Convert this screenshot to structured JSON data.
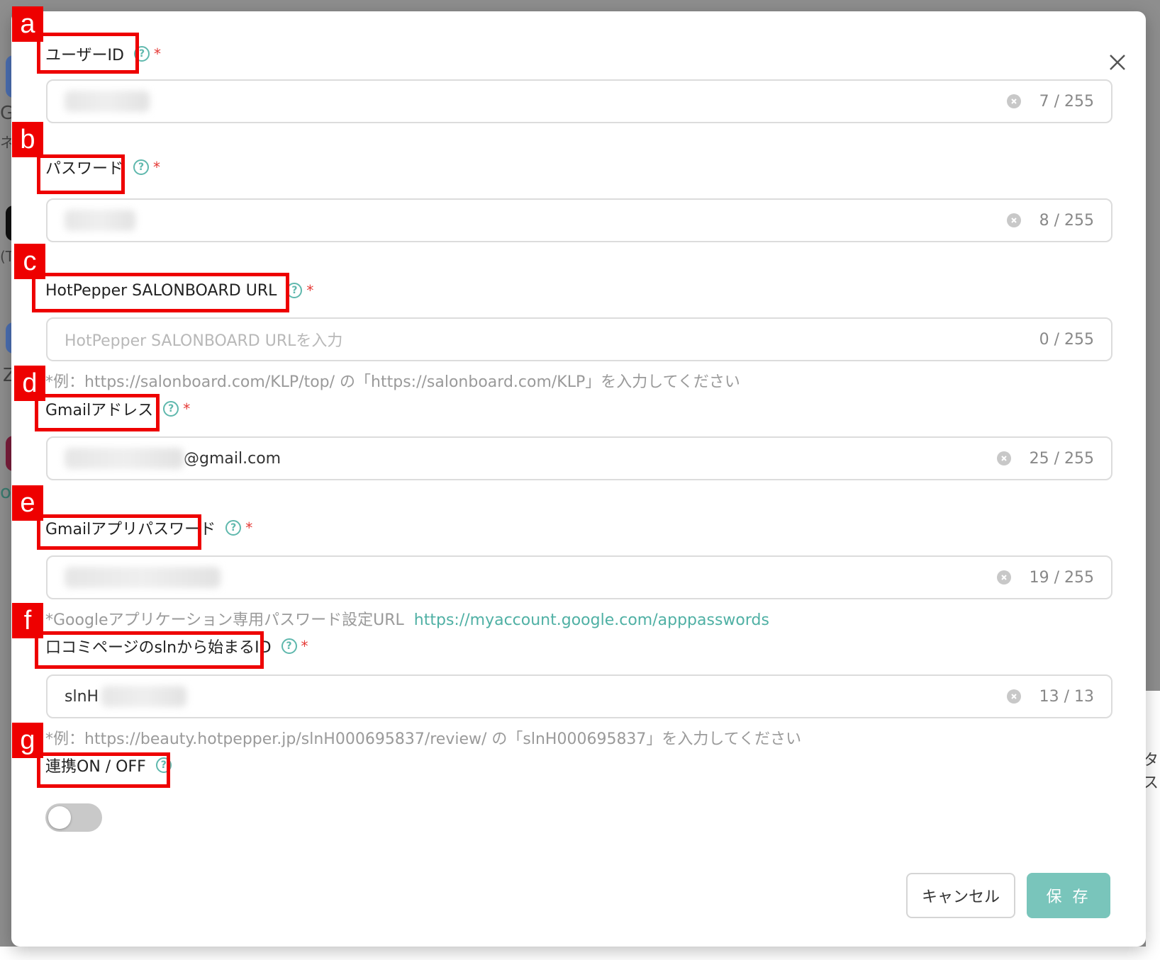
{
  "background": {
    "fragments": [
      "G",
      "ネス",
      "(T",
      "Z",
      "o",
      "タス"
    ]
  },
  "modal": {
    "fields": [
      {
        "label": "ユーザーID",
        "value_suffix": "",
        "placeholder": "",
        "counter": "7 / 255",
        "clearable": true
      },
      {
        "label": "パスワード",
        "value_suffix": "",
        "placeholder": "",
        "counter": "8 / 255",
        "clearable": true
      },
      {
        "label": "HotPepper SALONBOARD URL",
        "value_suffix": "",
        "placeholder": "HotPepper SALONBOARD URLを入力",
        "counter": "0 / 255",
        "clearable": false,
        "hint": "*例：https://salonboard.com/KLP/top/ の「https://salonboard.com/KLP」を入力してください"
      },
      {
        "label": "Gmailアドレス",
        "value_suffix": "@gmail.com",
        "placeholder": "",
        "counter": "25 / 255",
        "clearable": true
      },
      {
        "label": "Gmailアプリパスワード",
        "value_suffix": "",
        "placeholder": "",
        "counter": "19 / 255",
        "clearable": true,
        "hint": "*Googleアプリケーション専用パスワード設定URL",
        "hint_link": "https://myaccount.google.com/apppasswords"
      },
      {
        "label": "口コミページのslnから始まるID",
        "value_prefix": "slnH",
        "placeholder": "",
        "counter": "13 / 13",
        "clearable": true,
        "hint": "*例：https://beauty.hotpepper.jp/slnH000695837/review/ の「slnH000695837」を入力してください"
      },
      {
        "label": "連携ON / OFF",
        "toggle_on": false
      }
    ],
    "help_glyph": "?",
    "required_mark": "*",
    "cancel_label": "キャンセル",
    "save_label": "保 存"
  },
  "annotations": [
    "a",
    "b",
    "c",
    "d",
    "e",
    "f",
    "g"
  ],
  "colors": {
    "accent": "#5fb8ad",
    "save_button": "#79c5bb",
    "annotation_red": "#ee0000",
    "required": "#e53935"
  }
}
